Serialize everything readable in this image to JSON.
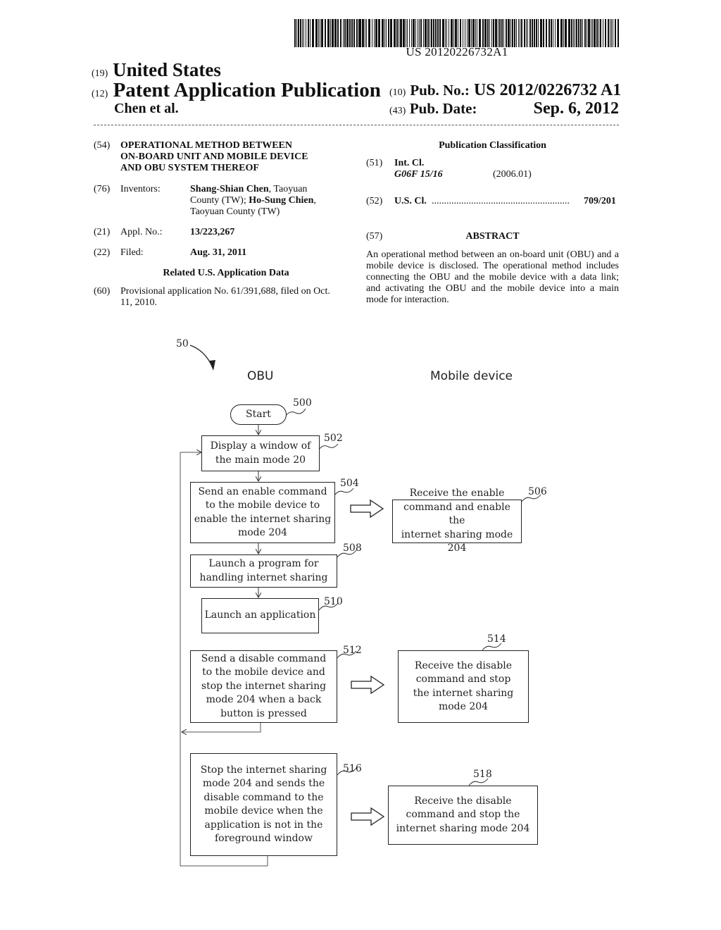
{
  "barcode": {
    "number": "US 20120226732A1"
  },
  "header": {
    "country_code": "(19)",
    "country": "United States",
    "doc_type_code": "(12)",
    "doc_type": "Patent Application Publication",
    "authors": "Chen et al.",
    "pub_no_code": "(10)",
    "pub_no_label": "Pub. No.:",
    "pub_no": "US 2012/0226732 A1",
    "pub_date_code": "(43)",
    "pub_date_label": "Pub. Date:",
    "pub_date": "Sep. 6, 2012"
  },
  "left_column": {
    "title": {
      "code": "(54)",
      "lines": [
        "OPERATIONAL METHOD BETWEEN",
        "ON-BOARD UNIT AND MOBILE DEVICE",
        "AND OBU SYSTEM THEREOF"
      ]
    },
    "inventors": {
      "code": "(76)",
      "label": "Inventors:",
      "name1": "Shang-Shian Chen",
      "loc1": ", Taoyuan",
      "line2_pre": "County (TW); ",
      "name2": "Ho-Sung Chien",
      "line2_post": ",",
      "line3": "Taoyuan County (TW)"
    },
    "appl_no": {
      "code": "(21)",
      "label": "Appl. No.:",
      "value": "13/223,267"
    },
    "filed": {
      "code": "(22)",
      "label": "Filed:",
      "value": "Aug. 31, 2011"
    },
    "related_heading": "Related U.S. Application Data",
    "provisional": {
      "code": "(60)",
      "line1": "Provisional application No. 61/391,688, filed on Oct.",
      "line2": "11, 2010."
    }
  },
  "right_column": {
    "classification_heading": "Publication Classification",
    "int_cl": {
      "code": "(51)",
      "label": "Int. Cl.",
      "class": "G06F 15/16",
      "version": "(2006.01)"
    },
    "us_cl": {
      "code": "(52)",
      "label": "U.S. Cl.",
      "dots": "........................................................",
      "value": "709/201"
    },
    "abstract": {
      "code": "(57)",
      "heading": "ABSTRACT",
      "text": "An operational method between an on-board unit (OBU) and a mobile device is disclosed. The operational method includes connecting the OBU and the mobile device with a data link; and activating the OBU and the mobile device into a main mode for interaction."
    }
  },
  "figure": {
    "figure_ref": "50",
    "lanes": {
      "left": "OBU",
      "right": "Mobile device"
    },
    "steps": [
      {
        "id": "500",
        "text": "Start"
      },
      {
        "id": "502",
        "lines": [
          "Display a window of",
          "the main mode 20"
        ]
      },
      {
        "id": "504",
        "lines": [
          "Send an enable command",
          "to the mobile device to",
          "enable the internet sharing",
          "mode 204"
        ]
      },
      {
        "id": "506",
        "lines": [
          "Receive the enable",
          "command and enable the",
          "internet sharing mode 204"
        ]
      },
      {
        "id": "508",
        "lines": [
          "Launch a program for",
          "handling internet sharing"
        ]
      },
      {
        "id": "510",
        "lines": [
          "Launch an application"
        ]
      },
      {
        "id": "512",
        "lines": [
          "Send a disable command",
          "to the mobile device and",
          "stop the internet sharing",
          "mode 204 when a back",
          "button is pressed"
        ]
      },
      {
        "id": "514",
        "lines": [
          "Receive the disable",
          "command and stop",
          "the internet sharing",
          "mode 204"
        ]
      },
      {
        "id": "516",
        "lines": [
          "Stop the internet sharing",
          "mode 204 and sends the",
          "disable command to the",
          "mobile device when the",
          "application is not in the",
          "foreground window"
        ]
      },
      {
        "id": "518",
        "lines": [
          "Receive the disable",
          "command and stop the",
          "internet sharing mode 204"
        ]
      }
    ]
  }
}
